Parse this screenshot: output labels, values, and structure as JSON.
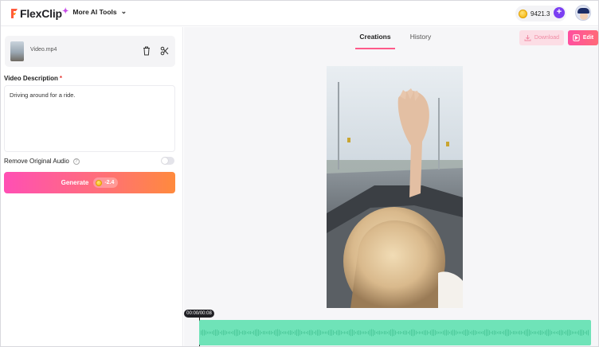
{
  "app": {
    "logo_text": "FlexClip",
    "tools_menu_label": "More AI Tools",
    "credits": "9421.3"
  },
  "left_panel": {
    "file_name": "Video.mp4",
    "description_label": "Video Description",
    "required_mark": "*",
    "description_text": "Driving around for a ride.",
    "remove_audio_label": "Remove Original Audio",
    "remove_audio_enabled": false,
    "generate_label": "Generate",
    "generate_cost": "-2.4"
  },
  "right_panel": {
    "tabs": [
      {
        "label": "Creations",
        "active": true
      },
      {
        "label": "History",
        "active": false
      }
    ],
    "download_label": "Download",
    "edit_label": "Edit",
    "timecode": "00:00/00:08"
  },
  "colors": {
    "accent_pink": "#ff4fb4",
    "accent_orange": "#ff8a3d",
    "waveform": "#6fe3b8",
    "plus_button": "#7b3ff2"
  },
  "icons": {
    "logo": "flexclip-logo-icon",
    "sparkle": "sparkle-icon",
    "chevron": "chevron-down-icon",
    "coin": "coin-icon",
    "plus": "plus-icon",
    "trash": "trash-icon",
    "scissors": "scissors-icon",
    "help": "help-circle-icon",
    "download": "download-icon",
    "edit": "edit-icon"
  }
}
